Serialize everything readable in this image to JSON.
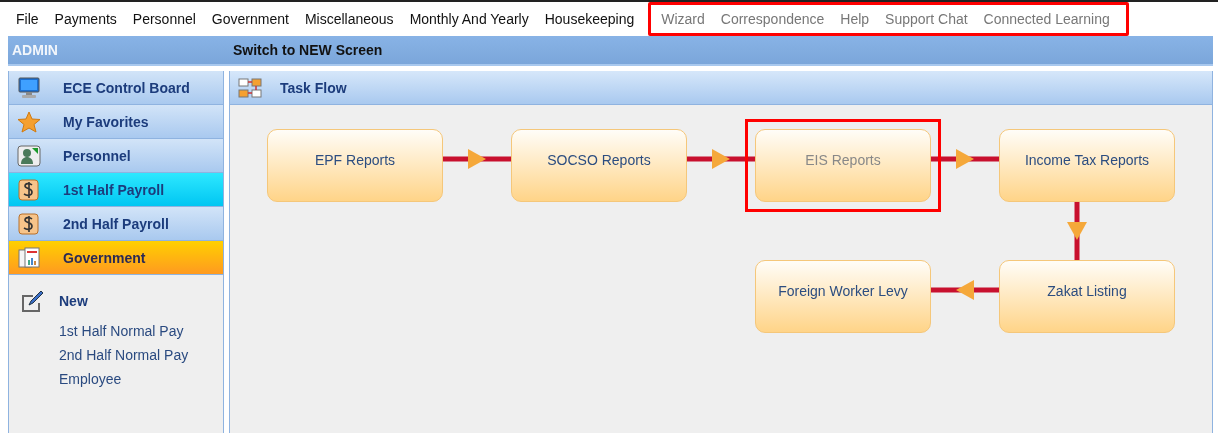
{
  "menu_groups": [
    {
      "annotated": false,
      "items": [
        {
          "label": "File",
          "disabled": false
        },
        {
          "label": "Payments",
          "disabled": false
        },
        {
          "label": "Personnel",
          "disabled": false
        },
        {
          "label": "Government",
          "disabled": false
        },
        {
          "label": "Miscellaneous",
          "disabled": false
        },
        {
          "label": "Monthly And Yearly",
          "disabled": false
        },
        {
          "label": "Housekeeping",
          "disabled": false
        }
      ]
    },
    {
      "annotated": true,
      "items": [
        {
          "label": "Wizard",
          "disabled": true
        },
        {
          "label": "Correspondence",
          "disabled": true
        },
        {
          "label": "Help",
          "disabled": true
        },
        {
          "label": "Support Chat",
          "disabled": true
        },
        {
          "label": "Connected Learning",
          "disabled": true
        }
      ]
    }
  ],
  "header": {
    "user": "ADMIN",
    "switch_link": "Switch to NEW Screen"
  },
  "sidebar": {
    "nav": [
      {
        "label": "ECE Control Board",
        "kind": "monitor",
        "selected": false,
        "hovered": false
      },
      {
        "label": "My Favorites",
        "kind": "star",
        "selected": false,
        "hovered": false
      },
      {
        "label": "Personnel",
        "kind": "people",
        "selected": false,
        "hovered": false
      },
      {
        "label": "1st  Half Payroll",
        "kind": "dollar",
        "selected": false,
        "hovered": true
      },
      {
        "label": "2nd Half Payroll",
        "kind": "dollar",
        "selected": false,
        "hovered": false
      },
      {
        "label": "Government",
        "kind": "report",
        "selected": true,
        "hovered": false
      }
    ],
    "action": "New",
    "links": [
      "1st  Half Normal Pay",
      "2nd Half Normal Pay",
      "Employee"
    ]
  },
  "panel": {
    "title": "Task Flow",
    "nodes": [
      {
        "label": "EPF Reports",
        "disabled": false,
        "annotated": false
      },
      {
        "label": "SOCSO Reports",
        "disabled": false,
        "annotated": false
      },
      {
        "label": "EIS Reports",
        "disabled": true,
        "annotated": true
      },
      {
        "label": "Income Tax Reports",
        "disabled": false,
        "annotated": false
      },
      {
        "label": "Foreign Worker Levy",
        "disabled": false,
        "annotated": false
      },
      {
        "label": "Zakat Listing",
        "disabled": false,
        "annotated": false
      }
    ]
  }
}
